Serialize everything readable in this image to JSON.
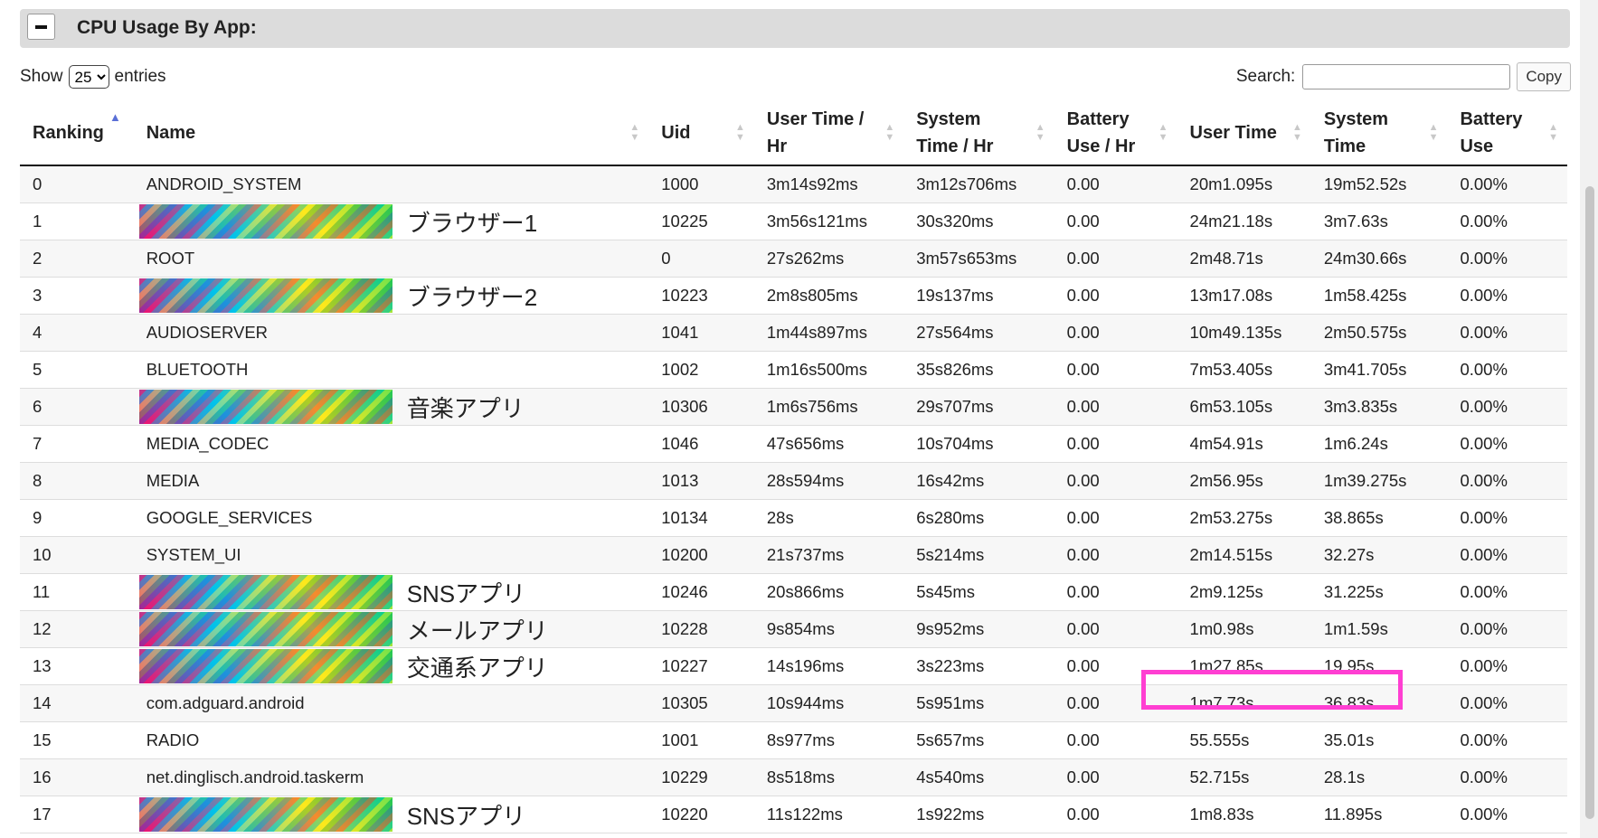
{
  "section": {
    "title": "CPU Usage By App:",
    "collapse_icon": "minus-icon"
  },
  "controls": {
    "show_label": "Show",
    "entries_value": "25",
    "entries_label": "entries",
    "search_label": "Search:",
    "search_value": "",
    "copy_label": "Copy"
  },
  "columns": [
    [
      "Ranking"
    ],
    [
      "Name"
    ],
    [
      "Uid"
    ],
    [
      "User Time /",
      "Hr"
    ],
    [
      "System",
      "Time / Hr"
    ],
    [
      "Battery",
      "Use / Hr"
    ],
    [
      "User Time"
    ],
    [
      "System",
      "Time"
    ],
    [
      "Battery",
      "Use"
    ]
  ],
  "sorted_column": "Ranking",
  "rows": [
    {
      "rank": "0",
      "name": "ANDROID_SYSTEM",
      "redacted": false,
      "uid": "1000",
      "uth": "3m14s92ms",
      "sth": "3m12s706ms",
      "buh": "0.00",
      "ut": "20m1.095s",
      "st": "19m52.52s",
      "bu": "0.00%"
    },
    {
      "rank": "1",
      "name": "ブラウザー1",
      "redacted": true,
      "uid": "10225",
      "uth": "3m56s121ms",
      "sth": "30s320ms",
      "buh": "0.00",
      "ut": "24m21.18s",
      "st": "3m7.63s",
      "bu": "0.00%"
    },
    {
      "rank": "2",
      "name": "ROOT",
      "redacted": false,
      "uid": "0",
      "uth": "27s262ms",
      "sth": "3m57s653ms",
      "buh": "0.00",
      "ut": "2m48.71s",
      "st": "24m30.66s",
      "bu": "0.00%"
    },
    {
      "rank": "3",
      "name": "ブラウザー2",
      "redacted": true,
      "uid": "10223",
      "uth": "2m8s805ms",
      "sth": "19s137ms",
      "buh": "0.00",
      "ut": "13m17.08s",
      "st": "1m58.425s",
      "bu": "0.00%"
    },
    {
      "rank": "4",
      "name": "AUDIOSERVER",
      "redacted": false,
      "uid": "1041",
      "uth": "1m44s897ms",
      "sth": "27s564ms",
      "buh": "0.00",
      "ut": "10m49.135s",
      "st": "2m50.575s",
      "bu": "0.00%"
    },
    {
      "rank": "5",
      "name": "BLUETOOTH",
      "redacted": false,
      "uid": "1002",
      "uth": "1m16s500ms",
      "sth": "35s826ms",
      "buh": "0.00",
      "ut": "7m53.405s",
      "st": "3m41.705s",
      "bu": "0.00%"
    },
    {
      "rank": "6",
      "name": "音楽アプリ",
      "redacted": true,
      "uid": "10306",
      "uth": "1m6s756ms",
      "sth": "29s707ms",
      "buh": "0.00",
      "ut": "6m53.105s",
      "st": "3m3.835s",
      "bu": "0.00%"
    },
    {
      "rank": "7",
      "name": "MEDIA_CODEC",
      "redacted": false,
      "uid": "1046",
      "uth": "47s656ms",
      "sth": "10s704ms",
      "buh": "0.00",
      "ut": "4m54.91s",
      "st": "1m6.24s",
      "bu": "0.00%"
    },
    {
      "rank": "8",
      "name": "MEDIA",
      "redacted": false,
      "uid": "1013",
      "uth": "28s594ms",
      "sth": "16s42ms",
      "buh": "0.00",
      "ut": "2m56.95s",
      "st": "1m39.275s",
      "bu": "0.00%"
    },
    {
      "rank": "9",
      "name": "GOOGLE_SERVICES",
      "redacted": false,
      "uid": "10134",
      "uth": "28s",
      "sth": "6s280ms",
      "buh": "0.00",
      "ut": "2m53.275s",
      "st": "38.865s",
      "bu": "0.00%"
    },
    {
      "rank": "10",
      "name": "SYSTEM_UI",
      "redacted": false,
      "uid": "10200",
      "uth": "21s737ms",
      "sth": "5s214ms",
      "buh": "0.00",
      "ut": "2m14.515s",
      "st": "32.27s",
      "bu": "0.00%"
    },
    {
      "rank": "11",
      "name": "SNSアプリ",
      "redacted": true,
      "uid": "10246",
      "uth": "20s866ms",
      "sth": "5s45ms",
      "buh": "0.00",
      "ut": "2m9.125s",
      "st": "31.225s",
      "bu": "0.00%"
    },
    {
      "rank": "12",
      "name": "メールアプリ",
      "redacted": true,
      "uid": "10228",
      "uth": "9s854ms",
      "sth": "9s952ms",
      "buh": "0.00",
      "ut": "1m0.98s",
      "st": "1m1.59s",
      "bu": "0.00%"
    },
    {
      "rank": "13",
      "name": "交通系アプリ",
      "redacted": true,
      "uid": "10227",
      "uth": "14s196ms",
      "sth": "3s223ms",
      "buh": "0.00",
      "ut": "1m27.85s",
      "st": "19.95s",
      "bu": "0.00%"
    },
    {
      "rank": "14",
      "name": "com.adguard.android",
      "redacted": false,
      "uid": "10305",
      "uth": "10s944ms",
      "sth": "5s951ms",
      "buh": "0.00",
      "ut": "1m7.73s",
      "st": "36.83s",
      "bu": "0.00%"
    },
    {
      "rank": "15",
      "name": "RADIO",
      "redacted": false,
      "uid": "1001",
      "uth": "8s977ms",
      "sth": "5s657ms",
      "buh": "0.00",
      "ut": "55.555s",
      "st": "35.01s",
      "bu": "0.00%"
    },
    {
      "rank": "16",
      "name": "net.dinglisch.android.taskerm",
      "redacted": false,
      "uid": "10229",
      "uth": "8s518ms",
      "sth": "4s540ms",
      "buh": "0.00",
      "ut": "52.715s",
      "st": "28.1s",
      "bu": "0.00%"
    },
    {
      "rank": "17",
      "name": "SNSアプリ",
      "redacted": true,
      "uid": "10220",
      "uth": "11s122ms",
      "sth": "1s922ms",
      "buh": "0.00",
      "ut": "1m8.83s",
      "st": "11.895s",
      "bu": "0.00%"
    }
  ],
  "colors": {
    "highlight": "#ff3fd2",
    "sort_active": "#5a6fd6",
    "header_bar": "#dcdcdc"
  }
}
